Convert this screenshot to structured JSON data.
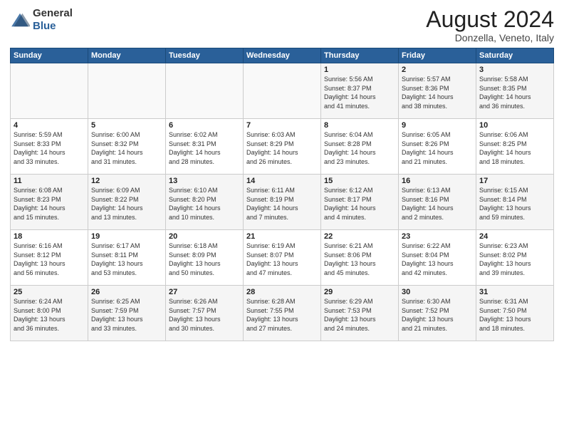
{
  "header": {
    "logo_general": "General",
    "logo_blue": "Blue",
    "month_title": "August 2024",
    "location": "Donzella, Veneto, Italy"
  },
  "weekdays": [
    "Sunday",
    "Monday",
    "Tuesday",
    "Wednesday",
    "Thursday",
    "Friday",
    "Saturday"
  ],
  "weeks": [
    [
      {
        "day": "",
        "info": ""
      },
      {
        "day": "",
        "info": ""
      },
      {
        "day": "",
        "info": ""
      },
      {
        "day": "",
        "info": ""
      },
      {
        "day": "1",
        "info": "Sunrise: 5:56 AM\nSunset: 8:37 PM\nDaylight: 14 hours\nand 41 minutes."
      },
      {
        "day": "2",
        "info": "Sunrise: 5:57 AM\nSunset: 8:36 PM\nDaylight: 14 hours\nand 38 minutes."
      },
      {
        "day": "3",
        "info": "Sunrise: 5:58 AM\nSunset: 8:35 PM\nDaylight: 14 hours\nand 36 minutes."
      }
    ],
    [
      {
        "day": "4",
        "info": "Sunrise: 5:59 AM\nSunset: 8:33 PM\nDaylight: 14 hours\nand 33 minutes."
      },
      {
        "day": "5",
        "info": "Sunrise: 6:00 AM\nSunset: 8:32 PM\nDaylight: 14 hours\nand 31 minutes."
      },
      {
        "day": "6",
        "info": "Sunrise: 6:02 AM\nSunset: 8:31 PM\nDaylight: 14 hours\nand 28 minutes."
      },
      {
        "day": "7",
        "info": "Sunrise: 6:03 AM\nSunset: 8:29 PM\nDaylight: 14 hours\nand 26 minutes."
      },
      {
        "day": "8",
        "info": "Sunrise: 6:04 AM\nSunset: 8:28 PM\nDaylight: 14 hours\nand 23 minutes."
      },
      {
        "day": "9",
        "info": "Sunrise: 6:05 AM\nSunset: 8:26 PM\nDaylight: 14 hours\nand 21 minutes."
      },
      {
        "day": "10",
        "info": "Sunrise: 6:06 AM\nSunset: 8:25 PM\nDaylight: 14 hours\nand 18 minutes."
      }
    ],
    [
      {
        "day": "11",
        "info": "Sunrise: 6:08 AM\nSunset: 8:23 PM\nDaylight: 14 hours\nand 15 minutes."
      },
      {
        "day": "12",
        "info": "Sunrise: 6:09 AM\nSunset: 8:22 PM\nDaylight: 14 hours\nand 13 minutes."
      },
      {
        "day": "13",
        "info": "Sunrise: 6:10 AM\nSunset: 8:20 PM\nDaylight: 14 hours\nand 10 minutes."
      },
      {
        "day": "14",
        "info": "Sunrise: 6:11 AM\nSunset: 8:19 PM\nDaylight: 14 hours\nand 7 minutes."
      },
      {
        "day": "15",
        "info": "Sunrise: 6:12 AM\nSunset: 8:17 PM\nDaylight: 14 hours\nand 4 minutes."
      },
      {
        "day": "16",
        "info": "Sunrise: 6:13 AM\nSunset: 8:16 PM\nDaylight: 14 hours\nand 2 minutes."
      },
      {
        "day": "17",
        "info": "Sunrise: 6:15 AM\nSunset: 8:14 PM\nDaylight: 13 hours\nand 59 minutes."
      }
    ],
    [
      {
        "day": "18",
        "info": "Sunrise: 6:16 AM\nSunset: 8:12 PM\nDaylight: 13 hours\nand 56 minutes."
      },
      {
        "day": "19",
        "info": "Sunrise: 6:17 AM\nSunset: 8:11 PM\nDaylight: 13 hours\nand 53 minutes."
      },
      {
        "day": "20",
        "info": "Sunrise: 6:18 AM\nSunset: 8:09 PM\nDaylight: 13 hours\nand 50 minutes."
      },
      {
        "day": "21",
        "info": "Sunrise: 6:19 AM\nSunset: 8:07 PM\nDaylight: 13 hours\nand 47 minutes."
      },
      {
        "day": "22",
        "info": "Sunrise: 6:21 AM\nSunset: 8:06 PM\nDaylight: 13 hours\nand 45 minutes."
      },
      {
        "day": "23",
        "info": "Sunrise: 6:22 AM\nSunset: 8:04 PM\nDaylight: 13 hours\nand 42 minutes."
      },
      {
        "day": "24",
        "info": "Sunrise: 6:23 AM\nSunset: 8:02 PM\nDaylight: 13 hours\nand 39 minutes."
      }
    ],
    [
      {
        "day": "25",
        "info": "Sunrise: 6:24 AM\nSunset: 8:00 PM\nDaylight: 13 hours\nand 36 minutes."
      },
      {
        "day": "26",
        "info": "Sunrise: 6:25 AM\nSunset: 7:59 PM\nDaylight: 13 hours\nand 33 minutes."
      },
      {
        "day": "27",
        "info": "Sunrise: 6:26 AM\nSunset: 7:57 PM\nDaylight: 13 hours\nand 30 minutes."
      },
      {
        "day": "28",
        "info": "Sunrise: 6:28 AM\nSunset: 7:55 PM\nDaylight: 13 hours\nand 27 minutes."
      },
      {
        "day": "29",
        "info": "Sunrise: 6:29 AM\nSunset: 7:53 PM\nDaylight: 13 hours\nand 24 minutes."
      },
      {
        "day": "30",
        "info": "Sunrise: 6:30 AM\nSunset: 7:52 PM\nDaylight: 13 hours\nand 21 minutes."
      },
      {
        "day": "31",
        "info": "Sunrise: 6:31 AM\nSunset: 7:50 PM\nDaylight: 13 hours\nand 18 minutes."
      }
    ]
  ]
}
